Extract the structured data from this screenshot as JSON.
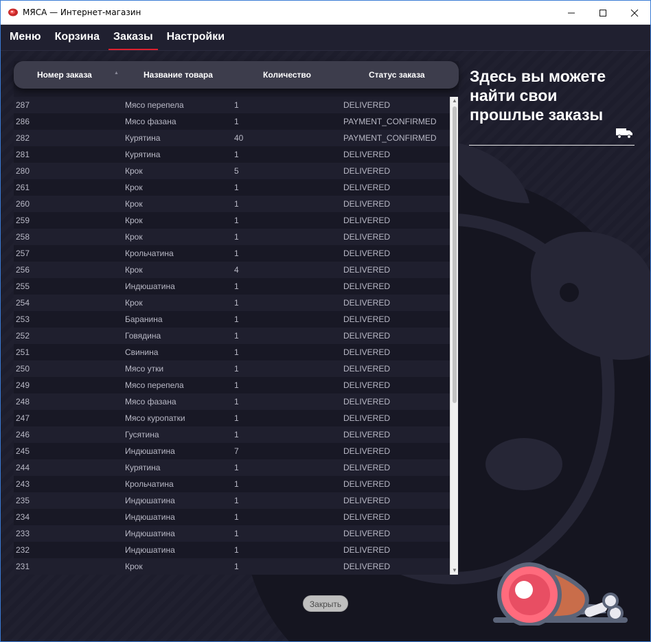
{
  "window": {
    "title": "МЯСА — Интернет-магазин"
  },
  "nav": {
    "items": [
      {
        "label": "Меню",
        "active": false
      },
      {
        "label": "Корзина",
        "active": false
      },
      {
        "label": "Заказы",
        "active": true
      },
      {
        "label": "Настройки",
        "active": false
      }
    ]
  },
  "table": {
    "headers": [
      "Номер заказа",
      "Название товара",
      "Количество",
      "Статус заказа"
    ],
    "rows": [
      [
        "287",
        "Мясо перепела",
        "1",
        "DELIVERED"
      ],
      [
        "286",
        "Мясо фазана",
        "1",
        "PAYMENT_CONFIRMED"
      ],
      [
        "282",
        "Курятина",
        "40",
        "PAYMENT_CONFIRMED"
      ],
      [
        "281",
        "Курятина",
        "1",
        "DELIVERED"
      ],
      [
        "280",
        "Крок",
        "5",
        "DELIVERED"
      ],
      [
        "261",
        "Крок",
        "1",
        "DELIVERED"
      ],
      [
        "260",
        "Крок",
        "1",
        "DELIVERED"
      ],
      [
        "259",
        "Крок",
        "1",
        "DELIVERED"
      ],
      [
        "258",
        "Крок",
        "1",
        "DELIVERED"
      ],
      [
        "257",
        "Крольчатина",
        "1",
        "DELIVERED"
      ],
      [
        "256",
        "Крок",
        "4",
        "DELIVERED"
      ],
      [
        "255",
        "Индюшатина",
        "1",
        "DELIVERED"
      ],
      [
        "254",
        "Крок",
        "1",
        "DELIVERED"
      ],
      [
        "253",
        "Баранина",
        "1",
        "DELIVERED"
      ],
      [
        "252",
        "Говядина",
        "1",
        "DELIVERED"
      ],
      [
        "251",
        "Свинина",
        "1",
        "DELIVERED"
      ],
      [
        "250",
        "Мясо утки",
        "1",
        "DELIVERED"
      ],
      [
        "249",
        "Мясо перепела",
        "1",
        "DELIVERED"
      ],
      [
        "248",
        "Мясо фазана",
        "1",
        "DELIVERED"
      ],
      [
        "247",
        "Мясо куропатки",
        "1",
        "DELIVERED"
      ],
      [
        "246",
        "Гусятина",
        "1",
        "DELIVERED"
      ],
      [
        "245",
        "Индюшатина",
        "7",
        "DELIVERED"
      ],
      [
        "244",
        "Курятина",
        "1",
        "DELIVERED"
      ],
      [
        "243",
        "Крольчатина",
        "1",
        "DELIVERED"
      ],
      [
        "235",
        "Индюшатина",
        "1",
        "DELIVERED"
      ],
      [
        "234",
        "Индюшатина",
        "1",
        "DELIVERED"
      ],
      [
        "233",
        "Индюшатина",
        "1",
        "DELIVERED"
      ],
      [
        "232",
        "Индюшатина",
        "1",
        "DELIVERED"
      ],
      [
        "231",
        "Крок",
        "1",
        "DELIVERED"
      ]
    ]
  },
  "info": {
    "title": "Здесь вы можете найти свои прошлые заказы",
    "icon": "truck-icon"
  },
  "footer": {
    "close_label": "Закрыть"
  },
  "colors": {
    "background": "#1d1d2c",
    "accent_underline": "#e0202e",
    "header_pill": "#3d3d4c"
  }
}
